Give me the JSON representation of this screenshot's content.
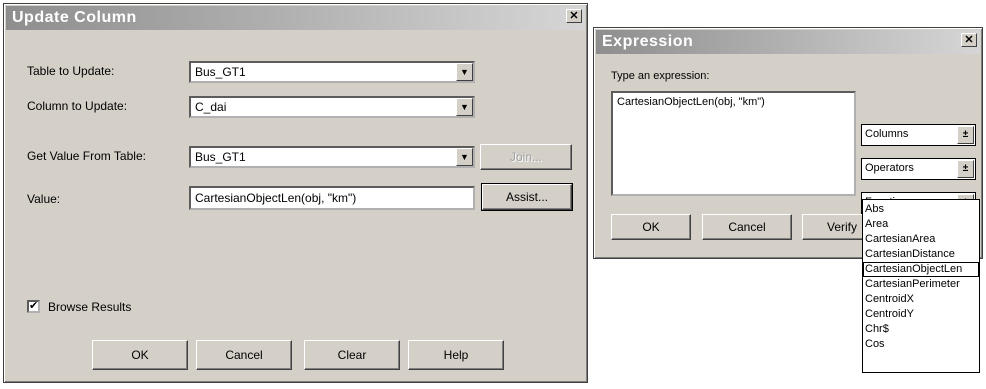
{
  "update_dialog": {
    "title": "Update Column",
    "close_glyph": "✕",
    "table_label": "Table to Update:",
    "table_value": "Bus_GT1",
    "column_label": "Column to Update:",
    "column_value": "C_dai",
    "getvalue_label": "Get Value From Table:",
    "getvalue_value": "Bus_GT1",
    "join_label": "Join...",
    "value_label": "Value:",
    "value_value": "CartesianObjectLen(obj, \"km\")",
    "assist_label": "Assist...",
    "browse_label": "Browse Results",
    "browse_checked": true,
    "ok_label": "OK",
    "cancel_label": "Cancel",
    "clear_label": "Clear",
    "help_label": "Help"
  },
  "expression_dialog": {
    "title": "Expression",
    "close_glyph": "✕",
    "prompt": "Type an expression:",
    "expression_text": "CartesianObjectLen(obj, \"km\")",
    "columns_label": "Columns",
    "operators_label": "Operators",
    "functions_label": "Functions",
    "ok_label": "OK",
    "cancel_label": "Cancel",
    "verify_label": "Verify",
    "functions_list": [
      "Abs",
      "Area",
      "CartesianArea",
      "CartesianDistance",
      "CartesianObjectLen",
      "CartesianPerimeter",
      "CentroidX",
      "CentroidY",
      "Chr$",
      "Cos"
    ],
    "selected_function": "CartesianObjectLen"
  },
  "icons": {
    "dropdown_arrow": "▼",
    "spin_arrow": "±",
    "check": "✔"
  }
}
